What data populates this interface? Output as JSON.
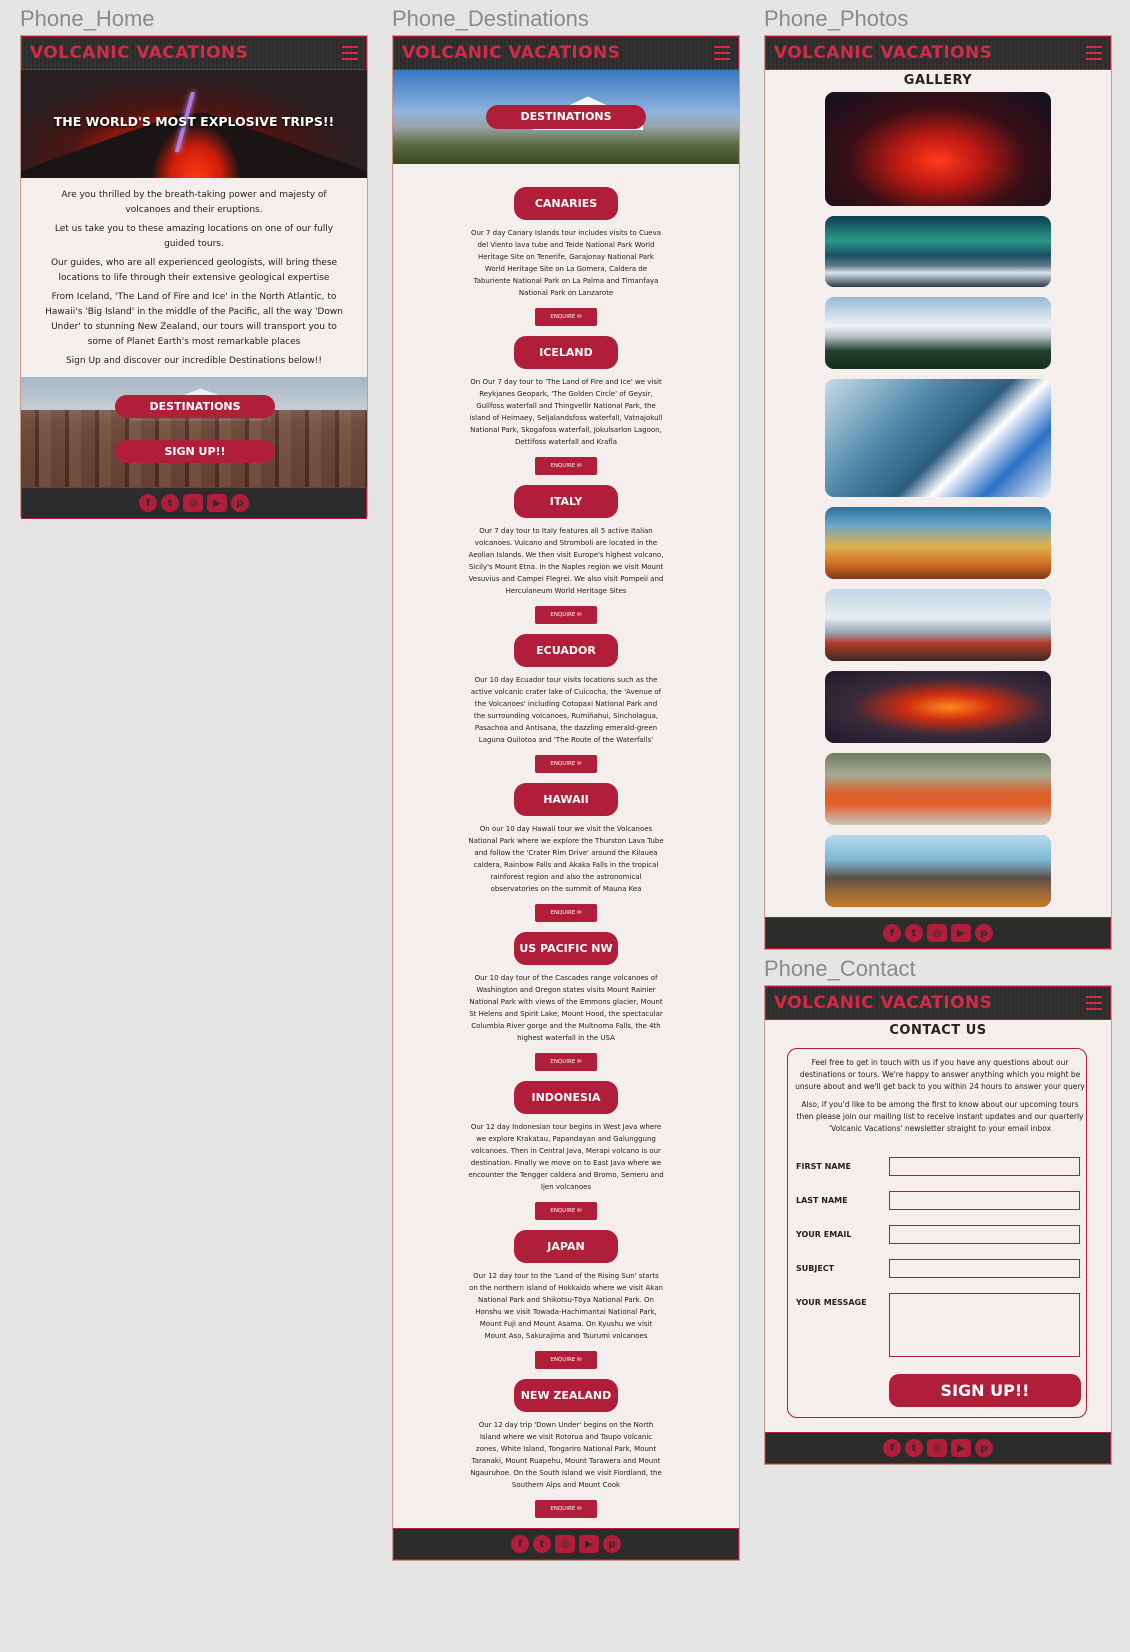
{
  "frames": {
    "home_label": "Phone_Home",
    "destinations_label": "Phone_Destinations",
    "photos_label": "Phone_Photos",
    "contact_label": "Phone_Contact"
  },
  "brand": "VOLCANIC VACATIONS",
  "colors": {
    "accent": "#b01e3a",
    "nav_bg": "#2c2c2c",
    "page_bg": "#f4efec",
    "canvas_bg": "#e5e5e5"
  },
  "social_icons": [
    "facebook-icon",
    "twitter-icon",
    "instagram-icon",
    "youtube-icon",
    "pinterest-icon"
  ],
  "home": {
    "hero_title": "THE WORLD'S MOST EXPLOSIVE TRIPS!!",
    "paragraphs": [
      "Are you thrilled by the breath-taking power and majesty of volcanoes and their eruptions.",
      "Let us take you to these amazing locations on one of our fully guided tours.",
      "Our guides, who are all experienced geologists, will bring these locations to life through their extensive geological expertise",
      "From Iceland, 'The Land of Fire and Ice' in the North Atlantic, to Hawaii's 'Big Island' in the middle of the Pacific, all the way 'Down Under'  to stunning New Zealand, our tours will transport you to some of Planet Earth's most remarkable places",
      "Sign Up and discover our incredible Destinations below!!"
    ],
    "destinations_button": "DESTINATIONS",
    "signup_button": "SIGN UP!!"
  },
  "destinations": {
    "hero_button": "DESTINATIONS",
    "enquire_label": "ENQUIRE",
    "items": [
      {
        "name": "CANARIES",
        "text": "Our 7 day Canary Islands tour includes visits to Cueva del Viento lava tube and Teide National Park World Heritage Site on Tenerife, Garajonay National Park World Heritage Site on La Gomera, Caldera de Taburiente National Park on La Palma and Timanfaya National  Park on Lanzarote"
      },
      {
        "name": "ICELAND",
        "text": "On Our 7 day tour to 'The Land of Fire and Ice' we visit Reykjanes Geopark,  'The Golden Circle' of Geysir, Gullfoss waterfall and Thingvellir National Park, the island of Heimaey, Seljalandsfoss waterfall, Vatnajokull National Park, Skogafoss waterfall, Jokulsarlon Lagoon, Dettifoss waterfall and Krafla"
      },
      {
        "name": "ITALY",
        "text": "Our 7 day tour to Italy features all 5 active Italian volcanoes. Vulcano and Stromboli are located in the Aeolian Islands. We then visit Europe's highest volcano, Sicily's Mount Etna. In the Naples region we visit Mount Vesuvius and Campei Flegrei. We also visit Pompeii and Herculaneum World Heritage Sites"
      },
      {
        "name": "ECUADOR",
        "text": "Our 10 day Ecuador tour visits locations such as the active volcanic crater lake of Cuicocha, the 'Avenue of the Volcanoes' including Cotopaxi National Park and the surrounding volcanoes, Rumiñahui, Sincholagua, Pasachoa and Antisana, the dazzling emerald-green Laguna Quilotoa and 'The Route of the Waterfalls'"
      },
      {
        "name": "HAWAII",
        "text": "On our 10 day Hawaii tour we visit the Volcanoes National Park where we explore the Thurston Lava Tube and follow the 'Crater Rim Drive' around the Kilauea caldera, Rainbow Falls and Akaka Falls in the tropical rainforest region and also the astronomical observatories on the summit of Mauna Kea"
      },
      {
        "name": "US PACIFIC NW",
        "text": "Our 10 day tour of the Cascades range volcanoes of Washington and Oregon states visits Mount Rainier National Park with views of the Emmons glacier, Mount St Helens and Spirit Lake, Mount Hood, the spectacular Columbia River gorge and the Multnoma Falls, the 4th highest waterfall in the USA"
      },
      {
        "name": "INDONESIA",
        "text": "Our 12 day Indonesian tour begins in West Java where we explore Krakatau, Papandayan and Galunggung volcanoes. Then in Central Java, Merapi volcano is our destination. Finally we move on to East Java where we encounter the Tengger caldera and Bromo, Semeru and Ijen volcanoes"
      },
      {
        "name": "JAPAN",
        "text": "Our 12 day tour to the 'Land of the Rising Sun' starts on the northern island of Hokkaido where we visit Akan National Park and Shikotsu-Tōya National Park. On Honshu we visit Towada-Hachimantai National Park, Mount Fuji and Mount Asama. On Kyushu we visit Mount Aso, Sakurajima and Tsurumi  volcanoes"
      },
      {
        "name": "NEW ZEALAND",
        "text": "Our 12 day trip 'Down Under' begins on the North Island where we visit Rotorua and Taupo volcanic zones, White Island, Tongariro National Park, Mount Taranaki, Mount Ruapehu, Mount Tarawera and Mount Ngauruhoe. On the South Island we visit Fiordland, the Southern Alps and Mount Cook"
      }
    ]
  },
  "photos": {
    "title": "GALLERY",
    "images": [
      "volcano-eruption-photo",
      "aurora-mountains-photo",
      "snowy-mountain-forest-photo",
      "santorini-photo",
      "hot-spring-photo",
      "mount-fuji-pagoda-photo",
      "lava-flow-photo",
      "geothermal-pool-photo",
      "bromo-volcano-photo"
    ]
  },
  "contact": {
    "title": "CONTACT US",
    "paragraphs": [
      "Feel free to get in touch with us if you have any questions about our destinations or tours. We're happy to answer anything which you might be unsure about and we'll get back to you within 24 hours to answer your query",
      "Also, if you'd like to be among the first to know about our upcoming tours then please join our mailing list to receive instant updates and our quarterly 'Volcanic Vacations' newsletter straight to your email inbox"
    ],
    "fields": {
      "first_name": "FIRST NAME",
      "last_name": "LAST NAME",
      "email": "YOUR EMAIL",
      "subject": "SUBJECT",
      "message": "YOUR MESSAGE"
    },
    "submit": "SIGN UP!!"
  }
}
